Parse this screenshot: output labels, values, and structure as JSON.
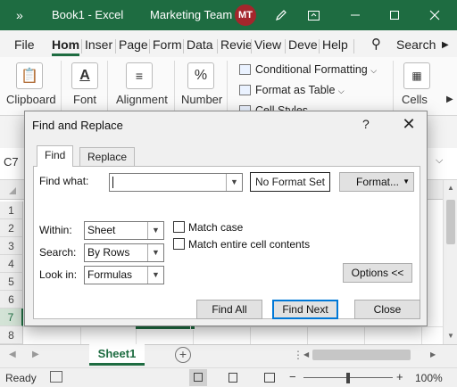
{
  "window": {
    "title": "Book1  -  Excel",
    "account_name": "Marketing Team",
    "avatar_initials": "MT",
    "accent_color": "#1e6c41"
  },
  "ribbon_tabs": [
    "File",
    "Hom",
    "Inser",
    "Page",
    "Form",
    "Data",
    "Revie",
    "View",
    "Deve",
    "Help"
  ],
  "search_label": "Search",
  "ribbon": {
    "clipboard": "Clipboard",
    "font": "Font",
    "alignment": "Alignment",
    "number": "Number",
    "number_icon": "%",
    "conditional_formatting": "Conditional Formatting",
    "format_as_table": "Format as Table",
    "cell_styles": "Cell Styles",
    "cells": "Cells"
  },
  "name_box": "C7",
  "row_numbers": [
    "1",
    "2",
    "3",
    "4",
    "5",
    "6",
    "7",
    "8"
  ],
  "selected_row": "7",
  "sheet_tab": "Sheet1",
  "status": {
    "ready": "Ready",
    "zoom": "100%"
  },
  "dialog": {
    "title": "Find and Replace",
    "help": "?",
    "tabs": {
      "find": "Find",
      "replace": "Replace"
    },
    "find_what_label": "Find what:",
    "find_what_value": "",
    "no_format_set": "No Format Set",
    "format_button": "Format...",
    "within_label": "Within:",
    "within_value": "Sheet",
    "search_label": "Search:",
    "search_value": "By Rows",
    "look_in_label": "Look in:",
    "look_in_value": "Formulas",
    "match_case_label": "Match case",
    "match_case_checked": false,
    "match_entire_label": "Match entire cell contents",
    "match_entire_checked": false,
    "options_button": "Options <<",
    "find_all_button": "Find All",
    "find_next_button": "Find Next",
    "close_button": "Close"
  }
}
